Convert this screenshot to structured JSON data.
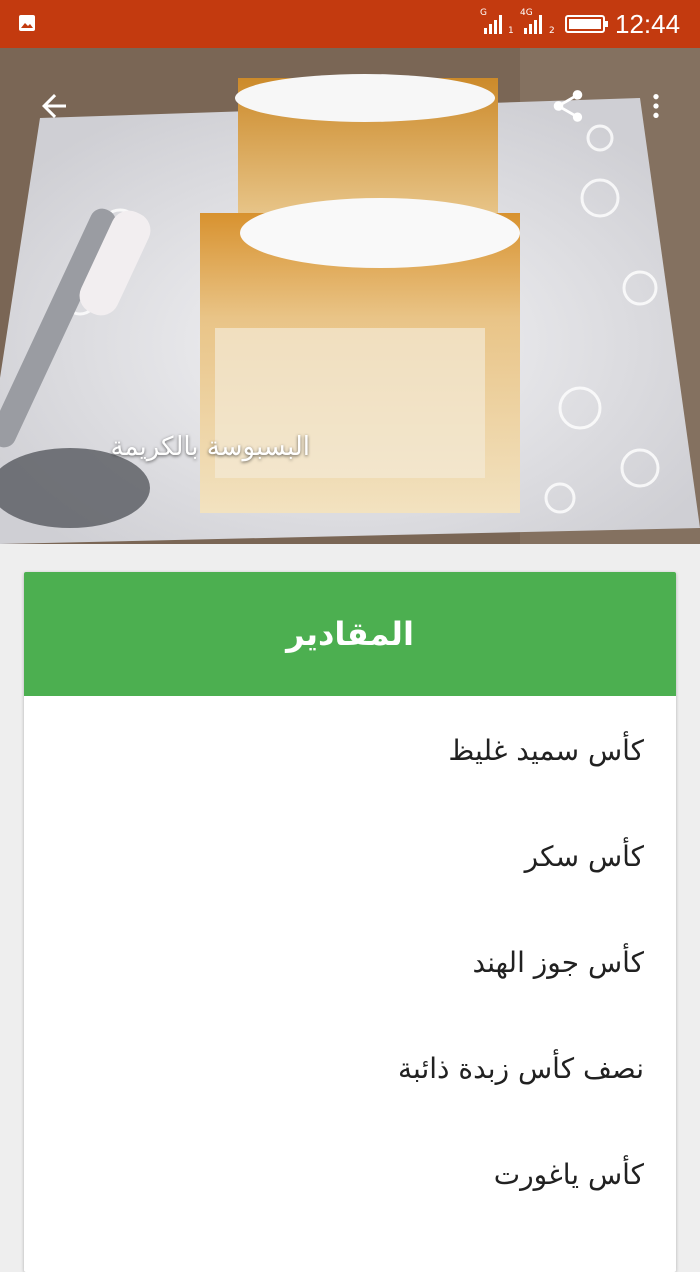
{
  "status_bar": {
    "time": "12:44",
    "network_1": "G",
    "network_2": "4G",
    "sim_1": "1",
    "sim_2": "2",
    "icons": [
      "gallery-icon",
      "signal-icon",
      "signal-icon",
      "battery-icon"
    ]
  },
  "app_bar": {
    "title": "البسبوسة بالكريمة",
    "icons": [
      "back-arrow-icon",
      "share-icon",
      "more-vert-icon"
    ]
  },
  "card": {
    "title": "المقادير",
    "header_color": "#4caf50",
    "ingredients": [
      "كأس سميد غليظ",
      "كأس سكر",
      "كأس جوز الهند",
      "نصف كأس زبدة ذائبة",
      "كأس ياغورت"
    ]
  },
  "colors": {
    "status_bar": "#c33a0f",
    "background": "#eeeeee"
  }
}
